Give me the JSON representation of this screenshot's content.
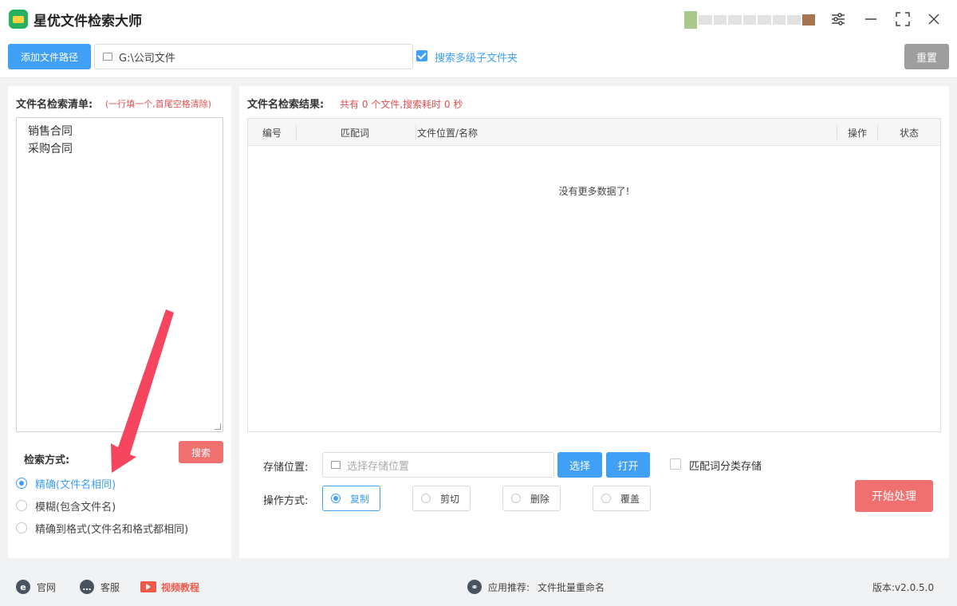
{
  "app": {
    "title": "星优文件检索大师"
  },
  "toolbar": {
    "add_path_label": "添加文件路径",
    "path_value": "G:\\公司文件",
    "search_subfolders_label": "搜索多级子文件夹",
    "search_subfolders_checked": true,
    "reset_label": "重置"
  },
  "left": {
    "list_title": "文件名检索清单:",
    "list_hint": "(一行填一个,首尾空格清除)",
    "keywords": [
      "销售合同",
      "采购合同"
    ],
    "search_button": "搜索",
    "mode_title": "检索方式:",
    "modes": [
      {
        "label": "精确(文件名相同)",
        "selected": true
      },
      {
        "label": "模糊(包含文件名)",
        "selected": false
      },
      {
        "label": "精确到格式(文件名和格式都相同)",
        "selected": false
      }
    ]
  },
  "right": {
    "results_title": "文件名检索结果:",
    "results_summary": "共有 0 个文件,搜索耗时 0 秒",
    "columns": [
      "编号",
      "匹配词",
      "文件位置/名称",
      "操作",
      "状态"
    ],
    "empty_text": "没有更多数据了!",
    "store_label": "存储位置:",
    "store_placeholder": "选择存储位置",
    "choose_button": "选择",
    "open_button": "打开",
    "classify_label": "匹配词分类存储",
    "classify_checked": false,
    "op_label": "操作方式:",
    "operations": [
      {
        "label": "复制",
        "selected": true
      },
      {
        "label": "剪切",
        "selected": false
      },
      {
        "label": "删除",
        "selected": false
      },
      {
        "label": "覆盖",
        "selected": false
      }
    ],
    "start_button": "开始处理"
  },
  "footer": {
    "website": "官网",
    "support": "客服",
    "video": "视频教程",
    "recommend_label": "应用推荐:",
    "recommend_app": "文件批量重命名",
    "version": "版本:v2.0.5.0"
  },
  "colors": {
    "accent": "#3fa0f5",
    "danger": "#f06f6f",
    "brand": "#27b05e"
  }
}
